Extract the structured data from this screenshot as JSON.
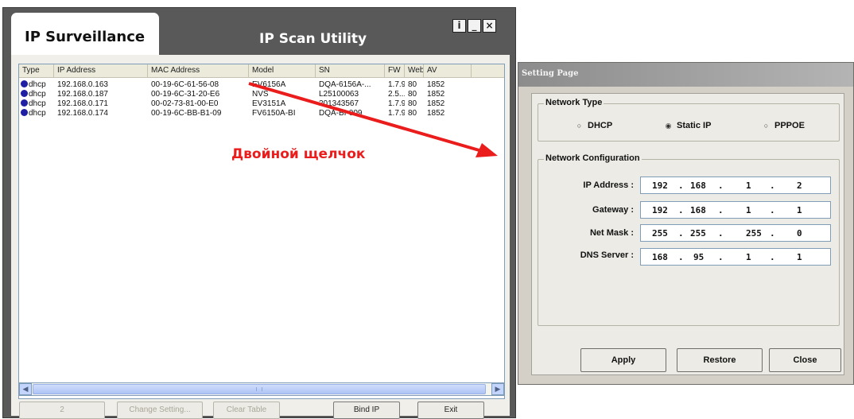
{
  "scan_window": {
    "brand": "IP Surveillance",
    "title": "IP Scan Utility",
    "controls": [
      "i",
      "_",
      "×"
    ],
    "columns": [
      "Type",
      "IP Address",
      "MAC Address",
      "Model",
      "SN",
      "FW",
      "Web",
      "AV"
    ],
    "rows": [
      {
        "type": "dhcp",
        "ip": "192.168.0.163",
        "mac": "00-19-6C-61-56-08",
        "model": "EV6156A",
        "sn": "DQA-6156A-...",
        "fw": "1.7.9",
        "web": "80",
        "av": "1852"
      },
      {
        "type": "dhcp",
        "ip": "192.168.0.187",
        "mac": "00-19-6C-31-20-E6",
        "model": "NVS",
        "sn": "L25100063",
        "fw": "2.5...",
        "web": "80",
        "av": "1852"
      },
      {
        "type": "dhcp",
        "ip": "192.168.0.171",
        "mac": "00-02-73-81-00-E0",
        "model": "EV3151A",
        "sn": "201343567",
        "fw": "1.7.9",
        "web": "80",
        "av": "1852"
      },
      {
        "type": "dhcp",
        "ip": "192.168.0.174",
        "mac": "00-19-6C-BB-B1-09",
        "model": "FV6150A-BI",
        "sn": "DQA-BI-009",
        "fw": "1.7.9",
        "web": "80",
        "av": "1852"
      }
    ],
    "buttons": {
      "b1": "2",
      "change": "Change Setting...",
      "clear": "Clear Table",
      "bind": "Bind IP",
      "exit": "Exit"
    }
  },
  "annotation": {
    "text": "Двойной щелчок",
    "color": "#ea1c1c"
  },
  "setting_window": {
    "title": "Setting Page",
    "network_type": {
      "label": "Network Type",
      "options": [
        {
          "label": "DHCP",
          "selected": false
        },
        {
          "label": "Static IP",
          "selected": true
        },
        {
          "label": "PPPOE",
          "selected": false
        }
      ]
    },
    "network_config": {
      "label": "Network Configuration",
      "fields": [
        {
          "label": "IP Address :",
          "octets": [
            "192",
            "168",
            "1",
            "2"
          ]
        },
        {
          "label": "Gateway :",
          "octets": [
            "192",
            "168",
            "1",
            "1"
          ]
        },
        {
          "label": "Net Mask :",
          "octets": [
            "255",
            "255",
            "255",
            "0"
          ]
        },
        {
          "label": "DNS Server :",
          "octets": [
            "168",
            "95",
            "1",
            "1"
          ]
        }
      ]
    },
    "buttons": {
      "apply": "Apply",
      "restore": "Restore",
      "close": "Close"
    }
  }
}
